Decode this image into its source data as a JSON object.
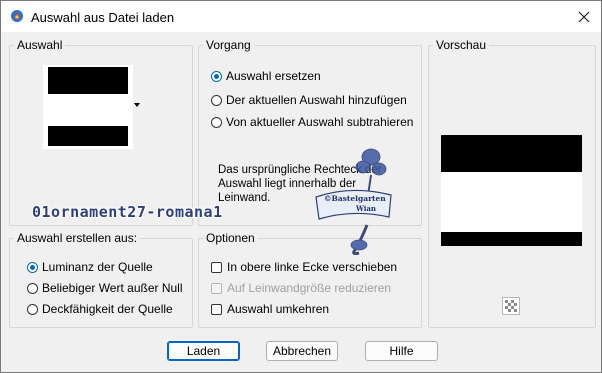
{
  "window": {
    "title": "Auswahl aus Datei laden",
    "app_icon": "psp-icon",
    "close_icon": "close-icon"
  },
  "auswahl": {
    "legend": "Auswahl",
    "dropdown_icon": "chevron-down-icon"
  },
  "vorgang": {
    "legend": "Vorgang",
    "options": [
      {
        "label": "Auswahl ersetzen",
        "checked": true
      },
      {
        "label": "Der aktuellen Auswahl hinzufügen",
        "checked": false
      },
      {
        "label": "Von aktueller Auswahl subtrahieren",
        "checked": false
      }
    ],
    "info_line1": "Das ursprüngliche Rechteck ",
    "info_line1_tail": "der",
    "info_line2": "Auswahl liegt innerhalb der",
    "info_line3": "Leinwand."
  },
  "vorschau": {
    "legend": "Vorschau",
    "transparency_icon": "checkerboard-icon"
  },
  "erstellen": {
    "legend": "Auswahl erstellen aus:",
    "options": [
      {
        "label": "Luminanz der Quelle",
        "checked": true
      },
      {
        "label": "Beliebiger Wert außer Null",
        "checked": false
      },
      {
        "label": "Deckfähigkeit der Quelle",
        "checked": false
      }
    ]
  },
  "optionen": {
    "legend": "Optionen",
    "checks": [
      {
        "label": "In obere linke Ecke verschieben",
        "enabled": true
      },
      {
        "label": "Auf Leinwandgröße reduzieren",
        "enabled": false
      },
      {
        "label": "Auswahl umkehren",
        "enabled": true
      }
    ]
  },
  "buttons": {
    "ok": "Laden",
    "cancel": "Abbrechen",
    "help": "Hilfe"
  },
  "watermark": {
    "text": "01ornament27-romana1",
    "stamp_line1": "©Bastelgarten",
    "stamp_line2": "Wian"
  },
  "colors": {
    "accent": "#0067c0",
    "border": "#d6d6d6",
    "watermark": "#2d3f7a"
  }
}
